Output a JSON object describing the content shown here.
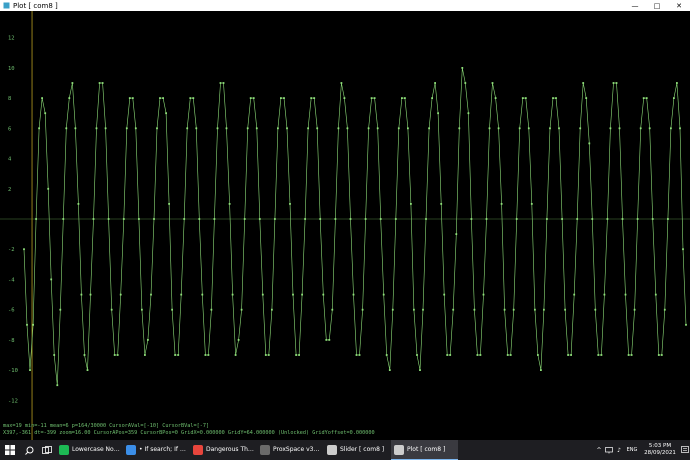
{
  "window": {
    "title": "Plot [ com8 ]",
    "minimize": "—",
    "maximize": "□",
    "close": "✕"
  },
  "chart_data": {
    "type": "line",
    "title": "",
    "xlabel": "",
    "ylabel": "",
    "ylim": [
      -13.5,
      13.5
    ],
    "y_ticks": [
      12,
      10,
      8,
      6,
      4,
      2,
      0,
      -2,
      -4,
      -6,
      -8,
      -10,
      -12
    ],
    "y_tick_labels": [
      "12",
      "10",
      "8",
      "6",
      "4",
      "2",
      "",
      "-2",
      "-4",
      "-6",
      "-8",
      "-10",
      "-12"
    ],
    "x_range": [
      0,
      412
    ],
    "grid": false,
    "zero_line": true,
    "cursor_x": 5,
    "series": [
      {
        "color": "#8fe07a",
        "values": [
          -2,
          -7,
          -10,
          -7,
          0,
          6,
          8,
          7,
          2,
          -4,
          -9,
          -11,
          -6,
          0,
          6,
          8,
          9,
          6,
          1,
          -5,
          -9,
          -10,
          -5,
          0,
          6,
          9,
          9,
          6,
          0,
          -6,
          -9,
          -9,
          -5,
          0,
          6,
          8,
          8,
          6,
          0,
          -6,
          -9,
          -8,
          -5,
          0,
          6,
          8,
          8,
          7,
          1,
          -6,
          -9,
          -9,
          -5,
          0,
          6,
          8,
          8,
          6,
          0,
          -5,
          -9,
          -9,
          -6,
          0,
          6,
          9,
          9,
          6,
          1,
          -5,
          -9,
          -8,
          -6,
          0,
          6,
          8,
          8,
          6,
          0,
          -5,
          -9,
          -9,
          -6,
          0,
          6,
          8,
          8,
          6,
          1,
          -5,
          -9,
          -9,
          -5,
          0,
          6,
          8,
          8,
          6,
          0,
          -5,
          -8,
          -8,
          -6,
          0,
          6,
          9,
          8,
          6,
          0,
          -5,
          -9,
          -9,
          -6,
          0,
          6,
          8,
          8,
          6,
          0,
          -5,
          -9,
          -10,
          -6,
          0,
          6,
          8,
          8,
          6,
          1,
          -6,
          -9,
          -10,
          -6,
          0,
          6,
          8,
          9,
          7,
          1,
          -5,
          -9,
          -9,
          -6,
          -1,
          6,
          10,
          9,
          7,
          0,
          -6,
          -9,
          -9,
          -5,
          0,
          6,
          9,
          8,
          6,
          1,
          -6,
          -9,
          -9,
          -6,
          0,
          6,
          8,
          8,
          6,
          1,
          -6,
          -9,
          -10,
          -6,
          0,
          6,
          8,
          8,
          6,
          0,
          -6,
          -9,
          -9,
          -5,
          0,
          6,
          9,
          8,
          5,
          0,
          -6,
          -9,
          -9,
          -5,
          0,
          6,
          9,
          9,
          6,
          0,
          -5,
          -9,
          -9,
          -6,
          0,
          6,
          8,
          8,
          6,
          0,
          -5,
          -9,
          -9,
          -6,
          0,
          6,
          8,
          9,
          6,
          -2,
          -7
        ]
      }
    ]
  },
  "status": {
    "line1": "max=19  min=-11  mean=6  p=164/30000  CursorAVal=[-10]  CursorBVal=[-7]",
    "line2": "X397,-361  dt=-399  zoom=16.00  CursorAPos=359  CursorBPos=0  GridX=0.000000  GridY=64.000000 (Unlocked)  GridYoffset=0.000000"
  },
  "taskbar": {
    "apps": [
      {
        "label": "Lowercase Noises -...",
        "color": "#1db954",
        "active": false
      },
      {
        "label": "• If search; If sear...",
        "color": "#3b8ee8",
        "active": false
      },
      {
        "label": "Dangerous Things ...",
        "color": "#e8453c",
        "active": false
      },
      {
        "label": "ProxSpace v3.9 - M...",
        "color": "#6a6a6a",
        "active": false
      },
      {
        "label": "Slider [ com8 ]",
        "color": "#cccccc",
        "active": false
      },
      {
        "label": "Plot [ com8 ]",
        "color": "#cccccc",
        "active": true
      }
    ],
    "time": "5:03 PM",
    "date": "28/09/2021",
    "tray_chevron": "^",
    "tray_speaker": "♪",
    "tray_lang": "ENG"
  }
}
